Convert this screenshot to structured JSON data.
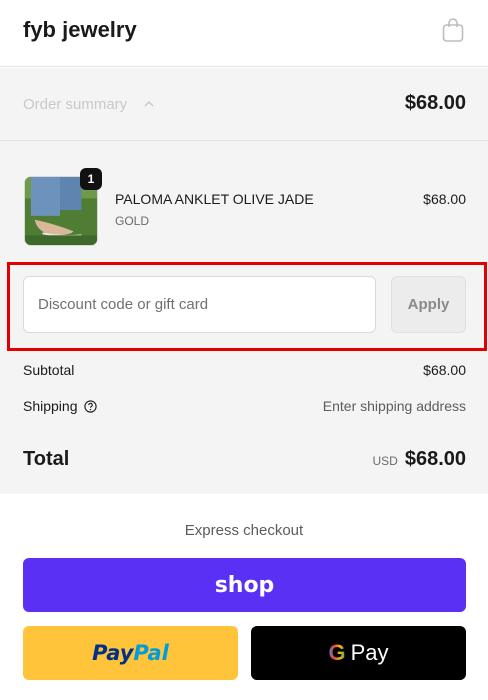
{
  "header": {
    "store_name": "fyb jewelry",
    "cart_icon": "shopping-bag-icon"
  },
  "summary": {
    "toggle_label": "Order summary",
    "toggle_icon": "chevron-up-icon",
    "amount": "$68.00"
  },
  "line_item": {
    "quantity": "1",
    "name": "PALOMA ANKLET OLIVE JADE",
    "variant": "GOLD",
    "price": "$68.00"
  },
  "discount": {
    "placeholder": "Discount code or gift card",
    "apply_label": "Apply"
  },
  "totals": {
    "subtotal_label": "Subtotal",
    "subtotal_value": "$68.00",
    "shipping_label": "Shipping",
    "shipping_icon": "help-circle-icon",
    "shipping_value": "Enter shipping address",
    "total_label": "Total",
    "currency": "USD",
    "total_value": "$68.00"
  },
  "express": {
    "label": "Express checkout",
    "shop_label": "shop",
    "paypal_label_a": "Pay",
    "paypal_label_b": "Pal",
    "gpay_g": "G",
    "gpay_label": "Pay"
  },
  "colors": {
    "shop_purple": "#5a31f4",
    "paypal_yellow": "#ffc439",
    "highlight_red": "#e50000"
  }
}
